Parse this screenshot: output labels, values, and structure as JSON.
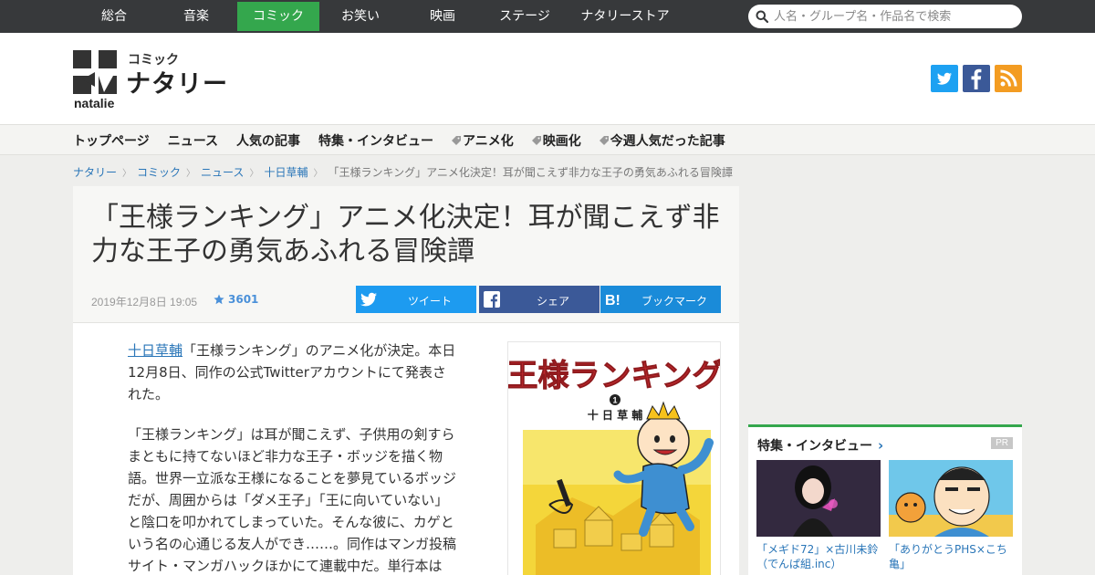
{
  "topnav": {
    "items": [
      "総合",
      "音楽",
      "コミック",
      "お笑い",
      "映画",
      "ステージ",
      "ナタリーストア"
    ],
    "active": "コミック"
  },
  "search": {
    "placeholder": "人名・グループ名・作品名で検索"
  },
  "logo": {
    "category": "コミック",
    "name": "ナタリー",
    "en": "natalie"
  },
  "subnav": {
    "items": [
      {
        "label": "トップページ",
        "tag": false
      },
      {
        "label": "ニュース",
        "tag": false
      },
      {
        "label": "人気の記事",
        "tag": false
      },
      {
        "label": "特集・インタビュー",
        "tag": false
      },
      {
        "label": "アニメ化",
        "tag": true
      },
      {
        "label": "映画化",
        "tag": true
      },
      {
        "label": "今週人気だった記事",
        "tag": true
      }
    ]
  },
  "breadcrumb": {
    "items": [
      "ナタリー",
      "コミック",
      "ニュース",
      "十日草輔"
    ],
    "current": "「王様ランキング」アニメ化決定！耳が聞こえず非力な王子の勇気あふれる冒険譚"
  },
  "article": {
    "title": "「王様ランキング」アニメ化決定！耳が聞こえず非力な王子の勇気あふれる冒険譚",
    "date": "2019年12月8日 19:05",
    "stars": "3601",
    "share": {
      "tweet": "ツイート",
      "facebook": "シェア",
      "hatena": "ブックマーク"
    },
    "p1_link": "十日草輔",
    "p1": "「王様ランキング」のアニメ化が決定。本日12月8日、同作の公式Twitterアカウントにて発表された。",
    "p2": "「王様ランキング」は耳が聞こえず、子供用の剣すらまともに持てないほど非力な王子・ボッジを描く物語。世界一立派な王様になることを夢見ているボッジだが、周囲からは「ダメ王子」「王に向いていない」と陰口を叩かれてしまっていた。そんな彼に、カゲという名の心通じる友人ができ……。同作はマンガ投稿サイト・マンガハックほかにて連載中だ。単行本は"
  },
  "cover": {
    "title": "王様ランキング",
    "volume": "1",
    "author": "十 日 草 輔"
  },
  "sidebar": {
    "heading": "特集・インタビュー",
    "pr": "PR",
    "cards": [
      {
        "caption": "「メギド72」×古川未鈴（でんぱ組.inc）"
      },
      {
        "caption": "「ありがとうPHS×こち亀」"
      }
    ]
  },
  "colors": {
    "accent": "#34a74d",
    "link": "#2a76b8",
    "topbar": "#37393b"
  }
}
